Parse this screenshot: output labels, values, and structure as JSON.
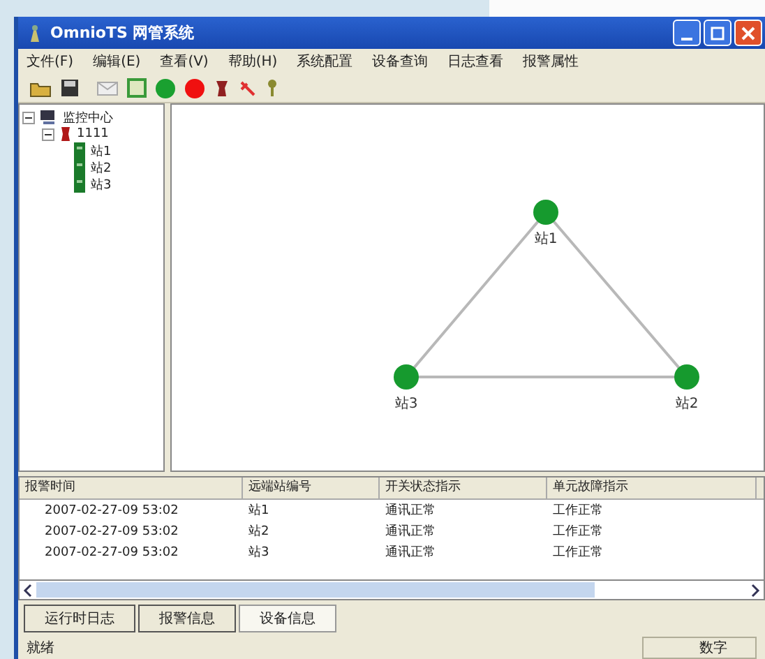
{
  "window": {
    "title": "OmnioTS 网管系统"
  },
  "menu": [
    "文件(F)",
    "编辑(E)",
    "查看(V)",
    "帮助(H)",
    "系统配置",
    "设备查询",
    "日志查看",
    "报警属性"
  ],
  "tree": [
    {
      "label": "监控中心",
      "expanded": true,
      "children": [
        {
          "label": "1111",
          "expanded": true,
          "children": [
            {
              "label": "站1"
            },
            {
              "label": "站2"
            },
            {
              "label": "站3"
            }
          ]
        }
      ]
    }
  ],
  "topology": {
    "nodes": [
      {
        "label": "站1"
      },
      {
        "label": "站2"
      },
      {
        "label": "站3"
      }
    ]
  },
  "table": {
    "columns": [
      "报警时间",
      "远端站编号",
      "开关状态指示",
      "单元故障指示"
    ],
    "rows": [
      [
        "2007-02-27-09 53:02",
        "站1",
        "通讯正常",
        "工作正常"
      ],
      [
        "2007-02-27-09 53:02",
        "站2",
        "通讯正常",
        "工作正常"
      ],
      [
        "2007-02-27-09 53:02",
        "站3",
        "通讯正常",
        "工作正常"
      ]
    ]
  },
  "tabs": [
    {
      "label": "运行时日志",
      "selected": false
    },
    {
      "label": "报警信息",
      "selected": false
    },
    {
      "label": "设备信息",
      "selected": true
    }
  ],
  "status_bar": {
    "left": "就绪",
    "right": "数字"
  }
}
